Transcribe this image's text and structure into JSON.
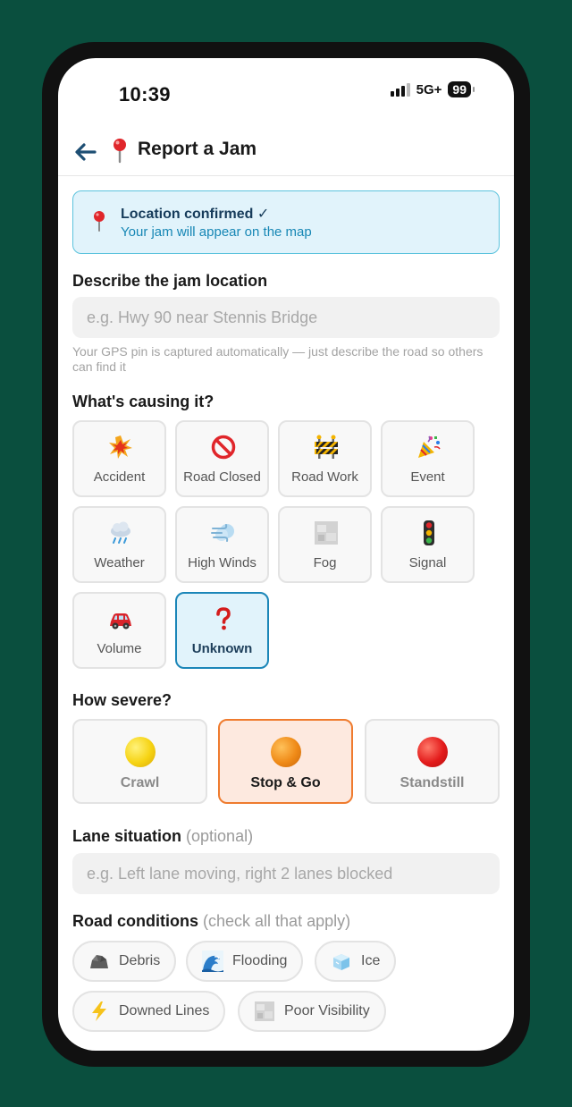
{
  "status_bar": {
    "time": "10:39",
    "network": "5G+",
    "battery": "99"
  },
  "header": {
    "title": "Report a Jam"
  },
  "banner": {
    "title": "Location confirmed ✓",
    "subtitle": "Your jam will appear on the map"
  },
  "location": {
    "label": "Describe the jam location",
    "placeholder": "e.g. Hwy 90 near Stennis Bridge",
    "hint": "Your GPS pin is captured automatically — just describe the road so others can find it"
  },
  "cause": {
    "label": "What's causing it?",
    "options": [
      {
        "label": "Accident",
        "icon": "collision-icon"
      },
      {
        "label": "Road Closed",
        "icon": "no-entry-icon"
      },
      {
        "label": "Road Work",
        "icon": "construction-barrier-icon"
      },
      {
        "label": "Event",
        "icon": "party-popper-icon"
      },
      {
        "label": "Weather",
        "icon": "rain-cloud-icon"
      },
      {
        "label": "High Winds",
        "icon": "wind-icon"
      },
      {
        "label": "Fog",
        "icon": "fog-icon"
      },
      {
        "label": "Signal",
        "icon": "traffic-light-icon"
      },
      {
        "label": "Volume",
        "icon": "car-icon"
      },
      {
        "label": "Unknown",
        "icon": "question-mark-icon"
      }
    ],
    "selected": "Unknown"
  },
  "severity": {
    "label": "How severe?",
    "options": [
      {
        "label": "Crawl",
        "color": "#f6cf13"
      },
      {
        "label": "Stop & Go",
        "color": "#ef8a17"
      },
      {
        "label": "Standstill",
        "color": "#e31b1b"
      }
    ],
    "selected": "Stop & Go"
  },
  "lanes": {
    "label": "Lane situation",
    "optional": "(optional)",
    "placeholder": "e.g. Left lane moving, right 2 lanes blocked"
  },
  "conditions": {
    "label": "Road conditions",
    "hint": "(check all that apply)",
    "options": [
      {
        "label": "Debris",
        "icon": "rock-icon"
      },
      {
        "label": "Flooding",
        "icon": "wave-icon"
      },
      {
        "label": "Ice",
        "icon": "ice-cube-icon"
      },
      {
        "label": "Downed Lines",
        "icon": "lightning-icon"
      },
      {
        "label": "Poor Visibility",
        "icon": "fog-icon"
      }
    ]
  },
  "colors": {
    "background": "#0a4f3e",
    "selected_blue": "#1b86b8",
    "selected_orange": "#ef7b2e",
    "banner_bg": "#e1f3fb"
  }
}
